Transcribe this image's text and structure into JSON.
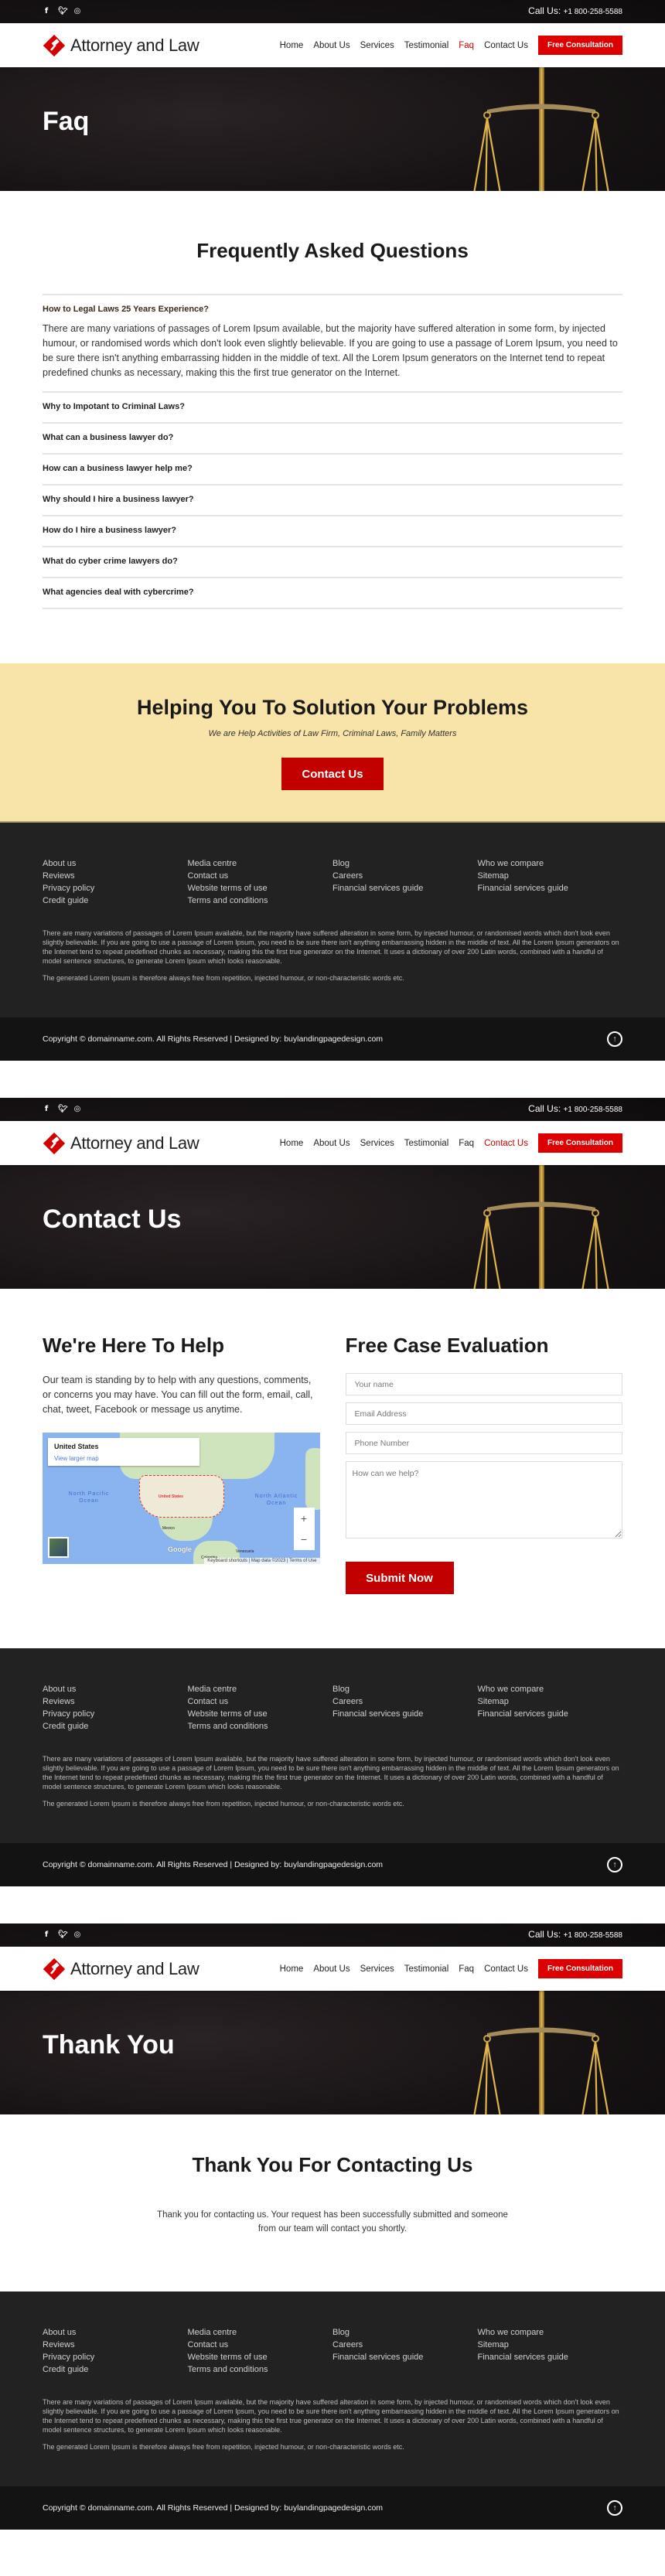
{
  "brand": {
    "name": "Attorney and Law",
    "accent": "#c80000",
    "cta_bg": "#f8e3a9",
    "footer_bg": "#222222"
  },
  "topbar": {
    "social_icons": [
      "facebook-icon",
      "twitter-icon",
      "instagram-icon"
    ],
    "call_label": "Call Us:",
    "phone": "+1 800-258-5588"
  },
  "nav": {
    "items": [
      "Home",
      "About Us",
      "Services",
      "Testimonial",
      "Faq",
      "Contact Us"
    ],
    "cta": "Free Consultation"
  },
  "footer": {
    "columns": [
      [
        "About us",
        "Reviews",
        "Privacy policy",
        "Credit guide"
      ],
      [
        "Media centre",
        "Contact us",
        "Website terms of use",
        "Terms and conditions"
      ],
      [
        "Blog",
        "Careers",
        "Financial services guide"
      ],
      [
        "Who we compare",
        "Sitemap",
        "Financial services guide"
      ]
    ],
    "text1": "There are many variations of passages of Lorem Ipsum available, but the majority have suffered alteration in some form, by injected humour, or randomised words which don't look even slightly believable. If you are going to use a passage of Lorem Ipsum, you need to be sure there isn't anything embarrassing hidden in the middle of text. All the Lorem Ipsum generators on the Internet tend to repeat predefined chunks as necessary, making this the first true generator on the Internet. It uses a dictionary of over 200 Latin words, combined with a handful of model sentence structures, to generate Lorem Ipsum which looks reasonable.",
    "text2": "The generated Lorem Ipsum is therefore always free from repetition, injected humour, or non-characteristic words etc.",
    "copyright": "Copyright © domainname.com. All Rights Reserved | Designed by: buylandingpagedesign.com"
  },
  "pages": [
    {
      "id": "faq",
      "hero_title": "Faq",
      "active_nav": "Faq"
    },
    {
      "id": "contact",
      "hero_title": "Contact Us",
      "active_nav": "Contact Us"
    },
    {
      "id": "thanks",
      "hero_title": "Thank You",
      "active_nav": ""
    }
  ],
  "faq": {
    "title": "Frequently Asked Questions",
    "items": [
      {
        "q": "How to Legal Laws 25 Years Experience?",
        "a": "There are many variations of passages of Lorem Ipsum available, but the majority have suffered alteration in some form, by injected humour, or randomised words which don't look even slightly believable. If you are going to use a passage of Lorem Ipsum, you need to be sure there isn't anything embarrassing hidden in the middle of text. All the Lorem Ipsum generators on the Internet tend to repeat predefined chunks as necessary, making this the first true generator on the Internet.",
        "open": true
      },
      {
        "q": "Why to Impotant to Criminal Laws?",
        "open": false
      },
      {
        "q": "What can a business lawyer do?",
        "open": false
      },
      {
        "q": "How can a business lawyer help me?",
        "open": false
      },
      {
        "q": "Why should I hire a business lawyer?",
        "open": false
      },
      {
        "q": "How do I hire a business lawyer?",
        "open": false
      },
      {
        "q": "What do cyber crime lawyers do?",
        "open": false
      },
      {
        "q": "What agencies deal with cybercrime?",
        "open": false
      }
    ]
  },
  "cta": {
    "title": "Helping You To Solution Your Problems",
    "subtitle": "We are Help Activities of Law Firm, Criminal Laws, Family Matters",
    "button": "Contact Us"
  },
  "contact": {
    "help_title": "We're Here To Help",
    "help_text": "Our team is standing by to help with any questions, comments, or concerns you may have. You can fill out the form, email, call, chat, tweet, Facebook or message us anytime.",
    "map": {
      "place": "United States",
      "view_link": "View larger map",
      "labels": [
        "North Pacific Ocean",
        "North Atlantic Ocean",
        "United States",
        "Mexico",
        "Venezuela",
        "Colombia"
      ],
      "footer": [
        "Keyboard shortcuts",
        "Map data ©2023",
        "Terms of Use"
      ],
      "zoom_in": "+",
      "zoom_out": "−",
      "logo": "Google"
    },
    "form_title": "Free Case Evaluation",
    "placeholders": {
      "name": "Your name",
      "email": "Email Address",
      "phone": "Phone Number",
      "message": "How can we help?"
    },
    "submit": "Submit Now"
  },
  "thanks": {
    "title": "Thank You For Contacting Us",
    "text": "Thank you for contacting us. Your request has been successfully submitted and someone from our team will contact you shortly."
  }
}
